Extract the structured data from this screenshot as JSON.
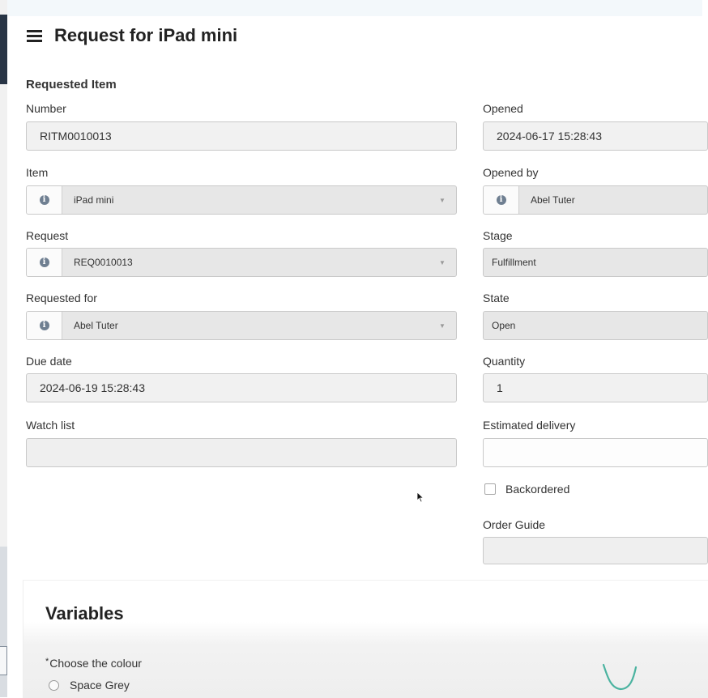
{
  "page": {
    "title": "Request for iPad mini"
  },
  "form": {
    "section_title": "Requested Item",
    "left": {
      "number": {
        "label": "Number",
        "value": "RITM0010013"
      },
      "item": {
        "label": "Item",
        "value": "iPad mini"
      },
      "request": {
        "label": "Request",
        "value": "REQ0010013"
      },
      "requested_for": {
        "label": "Requested for",
        "value": "Abel Tuter"
      },
      "due_date": {
        "label": "Due date",
        "value": "2024-06-19 15:28:43"
      },
      "watch_list": {
        "label": "Watch list",
        "value": ""
      }
    },
    "right": {
      "opened": {
        "label": "Opened",
        "value": "2024-06-17 15:28:43"
      },
      "opened_by": {
        "label": "Opened by",
        "value": "Abel Tuter"
      },
      "stage": {
        "label": "Stage",
        "value": "Fulfillment"
      },
      "state": {
        "label": "State",
        "value": "Open"
      },
      "quantity": {
        "label": "Quantity",
        "value": "1"
      },
      "estimated_delivery": {
        "label": "Estimated delivery",
        "value": ""
      },
      "backordered": {
        "label": "Backordered",
        "checked": false
      },
      "order_guide": {
        "label": "Order Guide",
        "value": ""
      }
    }
  },
  "variables": {
    "title": "Variables",
    "colour_question": {
      "required_mark": "*",
      "label": "Choose the colour"
    },
    "options": [
      {
        "label": "Space Grey",
        "selected": false
      }
    ]
  },
  "icons": {
    "menu": "hamburger-menu-icon",
    "reference_info": "info-circle-icon",
    "dropdown": "chevron-down-icon",
    "pointer": "mouse-cursor-icon"
  },
  "colors": {
    "field_background": "#f1f1f1",
    "field_border": "#c9c9c9",
    "info_icon": "#6f7f91",
    "nav_dark": "#283445"
  }
}
